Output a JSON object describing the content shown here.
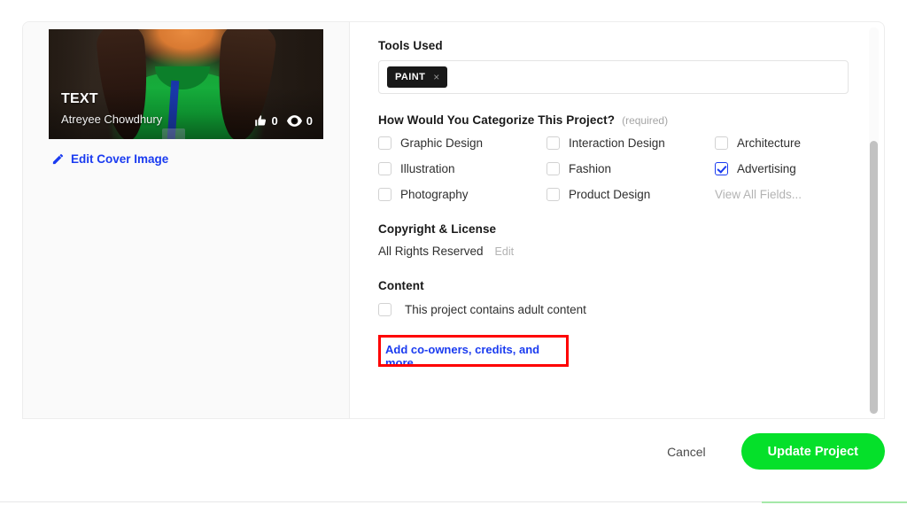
{
  "dialog": {
    "cover": {
      "title": "TEXT",
      "author": "Atreyee Chowdhury",
      "likes": "0",
      "views": "0",
      "like_icon": "thumbs-up-icon",
      "view_icon": "eye-icon",
      "edit_link": "Edit Cover Image",
      "edit_icon": "pencil-icon"
    },
    "tools": {
      "label": "Tools Used",
      "tags": [
        {
          "name": "PAINT",
          "remove_icon": "×"
        }
      ]
    },
    "categories": {
      "label": "How Would You Categorize This Project?",
      "required_note": "(required)",
      "options": [
        {
          "label": "Graphic Design",
          "checked": false
        },
        {
          "label": "Interaction Design",
          "checked": false
        },
        {
          "label": "Architecture",
          "checked": false
        },
        {
          "label": "Illustration",
          "checked": false
        },
        {
          "label": "Fashion",
          "checked": false
        },
        {
          "label": "Advertising",
          "checked": true
        },
        {
          "label": "Photography",
          "checked": false
        },
        {
          "label": "Product Design",
          "checked": false
        }
      ],
      "view_all": "View All Fields..."
    },
    "copyright": {
      "label": "Copyright & License",
      "value": "All Rights Reserved",
      "edit_label": "Edit"
    },
    "content": {
      "label": "Content",
      "adult_checkbox": {
        "label": "This project contains adult content",
        "checked": false
      }
    },
    "coowners_link": "Add co-owners, credits, and more...",
    "footer": {
      "cancel_label": "Cancel",
      "update_label": "Update Project"
    }
  },
  "colors": {
    "accent_blue": "#1a3bf0",
    "primary_green": "#05e02a",
    "annotation_red": "#fe0000",
    "tag_dark": "#191919"
  }
}
